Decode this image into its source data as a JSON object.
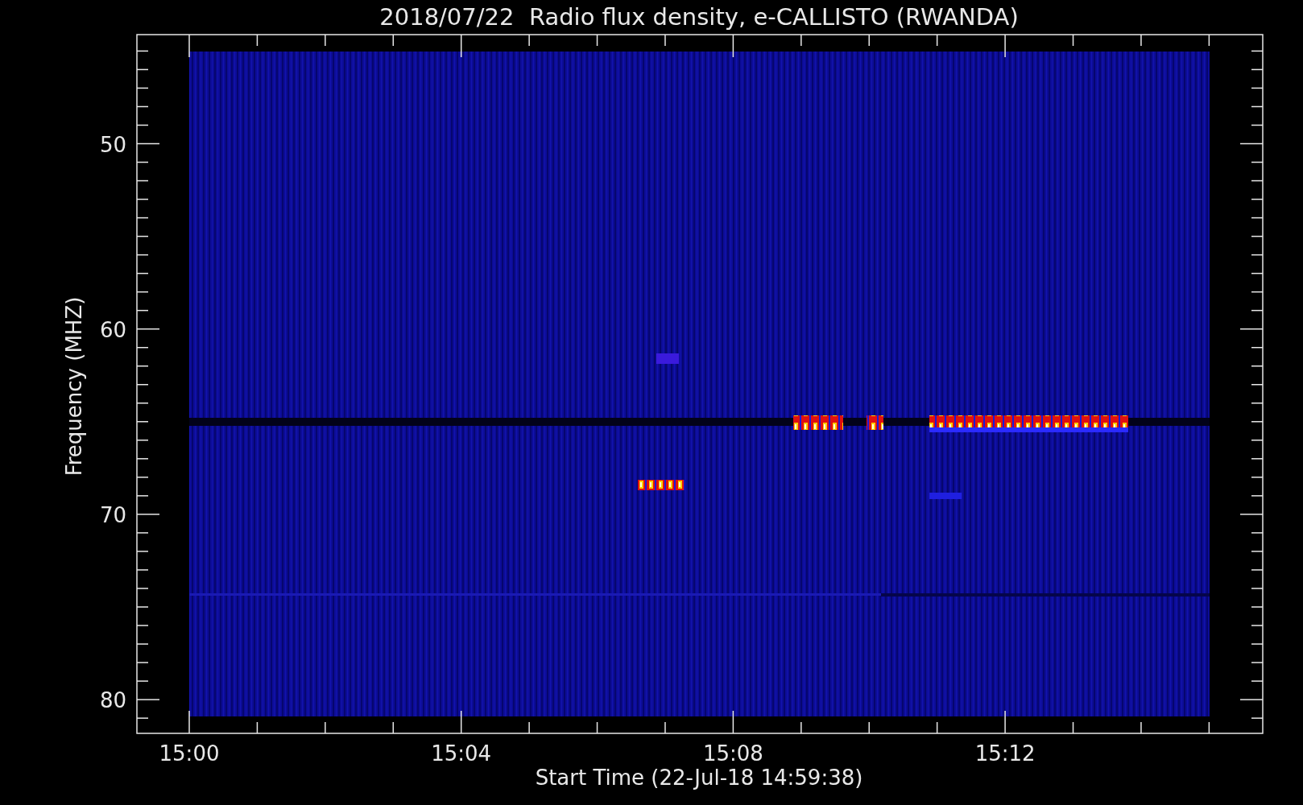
{
  "plot": {
    "title": "2018/07/22  Radio flux density, e-CALLISTO (RWANDA)",
    "xlabel": "Start Time (22-Jul-18 14:59:38)",
    "ylabel": "Frequency (MHZ)",
    "x_tick_labels": [
      "15:00",
      "15:04",
      "15:08",
      "15:12"
    ],
    "y_tick_labels": [
      "50",
      "60",
      "70",
      "80"
    ]
  }
}
